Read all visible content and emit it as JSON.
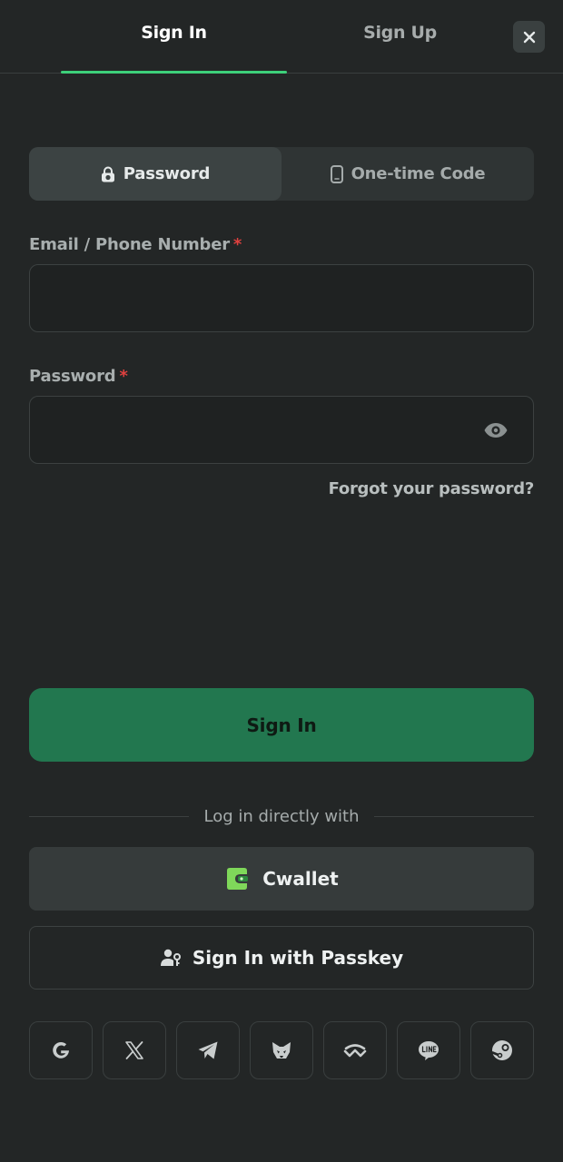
{
  "tabs": {
    "signin": "Sign In",
    "signup": "Sign Up"
  },
  "methods": {
    "password": "Password",
    "otp": "One-time Code"
  },
  "fields": {
    "email_label": "Email / Phone Number",
    "password_label": "Password",
    "required_mark": "*",
    "email_value": "",
    "password_value": ""
  },
  "forgot": "Forgot your password?",
  "submit": "Sign In",
  "divider": "Log in directly with",
  "cwallet": "Cwallet",
  "passkey": "Sign In with Passkey",
  "socials": [
    "google-icon",
    "x-icon",
    "telegram-icon",
    "metamask-icon",
    "walletconnect-icon",
    "line-icon",
    "steam-icon"
  ],
  "colors": {
    "accent": "#3dd07a",
    "primary_button": "#22774f",
    "required": "#e0413f",
    "background": "#232626"
  }
}
